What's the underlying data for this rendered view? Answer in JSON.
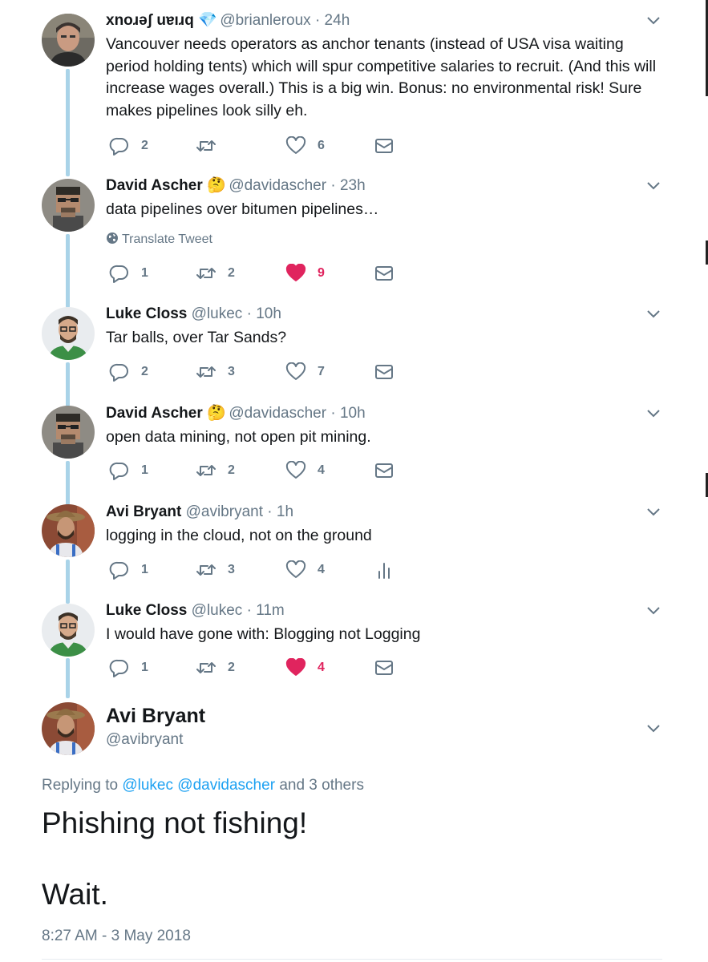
{
  "thread": [
    {
      "name": "xnoɹǝʃ uɐıɹq",
      "emoji": "💎",
      "handle": "@brianleroux",
      "time": "· 24h",
      "text": "Vancouver needs operators as anchor tenants (instead of USA visa waiting period holding tents) which will spur competitive salaries to recruit. (And this will increase wages overall.) This is a big win. Bonus: no environmental risk! Sure makes pipelines look silly eh.",
      "replies": "2",
      "retweets": "",
      "likes": "6",
      "liked": false,
      "last_action": "mail-icon"
    },
    {
      "name": "David Ascher",
      "emoji": "🤔",
      "handle": "@davidascher",
      "time": "· 23h",
      "text": "data pipelines over bitumen pipelines…",
      "translate": "Translate Tweet",
      "replies": "1",
      "retweets": "2",
      "likes": "9",
      "liked": true,
      "last_action": "mail-icon"
    },
    {
      "name": "Luke Closs",
      "emoji": "",
      "handle": "@lukec",
      "time": "· 10h",
      "text": "Tar balls, over Tar Sands?",
      "replies": "2",
      "retweets": "3",
      "likes": "7",
      "liked": false,
      "last_action": "mail-icon"
    },
    {
      "name": "David Ascher",
      "emoji": "🤔",
      "handle": "@davidascher",
      "time": "· 10h",
      "text": "open data mining, not open pit mining.",
      "replies": "1",
      "retweets": "2",
      "likes": "4",
      "liked": false,
      "last_action": "mail-icon"
    },
    {
      "name": "Avi Bryant",
      "emoji": "",
      "handle": "@avibryant",
      "time": "· 1h",
      "text": "logging in the cloud, not on the ground",
      "replies": "1",
      "retweets": "3",
      "likes": "4",
      "liked": false,
      "last_action": "analytics-icon"
    },
    {
      "name": "Luke Closs",
      "emoji": "",
      "handle": "@lukec",
      "time": "· 11m",
      "text": "I would have gone with: Blogging not Logging",
      "replies": "1",
      "retweets": "2",
      "likes": "4",
      "liked": true,
      "last_action": "mail-icon"
    }
  ],
  "main": {
    "name": "Avi Bryant",
    "handle": "@avibryant",
    "replying_prefix": "Replying to",
    "mention1": "@lukec",
    "mention2": "@davidascher",
    "replying_suffix": "and 3 others",
    "text_line1": "Phishing not fishing!",
    "text_line2": "Wait.",
    "timestamp": "8:27 AM - 3 May 2018"
  },
  "colors": {
    "accent": "#1da1f2",
    "like": "#e0245e",
    "muted": "#657786",
    "thread_line": "#a9d3e8"
  }
}
